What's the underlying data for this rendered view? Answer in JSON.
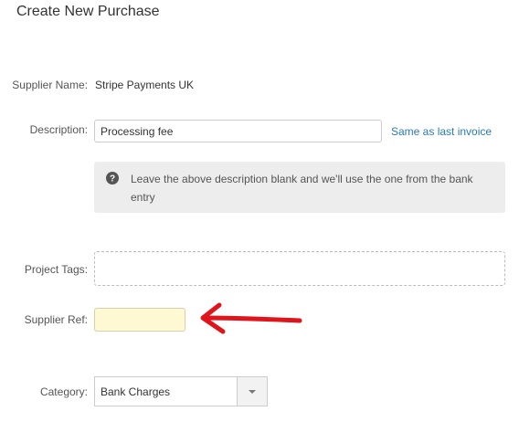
{
  "page": {
    "title": "Create New Purchase"
  },
  "form": {
    "supplier_name": {
      "label": "Supplier Name:",
      "value": "Stripe Payments UK"
    },
    "description": {
      "label": "Description:",
      "value": "Processing fee",
      "link_label": "Same as last invoice"
    },
    "info": {
      "icon": "question-circle-icon",
      "text": "Leave the above description blank and we'll use the one from the bank entry"
    },
    "project_tags": {
      "label": "Project Tags:",
      "value": ""
    },
    "supplier_ref": {
      "label": "Supplier Ref:",
      "value": ""
    },
    "category": {
      "label": "Category:",
      "selected": "Bank Charges"
    }
  },
  "annotation": {
    "arrow_color": "#e0141b"
  },
  "colors": {
    "link": "#2a7ab8",
    "info_background": "#ededed",
    "supplier_ref_background": "#fff9d3"
  }
}
